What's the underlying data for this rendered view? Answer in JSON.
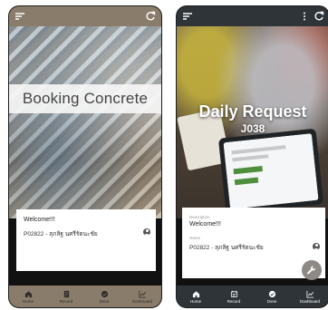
{
  "left_app": {
    "banner_title": "Booking Concrete",
    "welcome": "Welcome!!!",
    "user": "P02822 - สุภสิฐ นศรีรัตนะชัย",
    "nav": [
      {
        "label": "Home",
        "icon": "home-icon"
      },
      {
        "label": "Record",
        "icon": "record-icon"
      },
      {
        "label": "Done",
        "icon": "check-circle-icon"
      },
      {
        "label": "Dashboard",
        "icon": "chart-icon"
      }
    ],
    "colors": {
      "bar": "#8a7c6a"
    }
  },
  "right_app": {
    "title": "Daily Request",
    "code": "J038",
    "description_label": "Description",
    "welcome": "Welcome!!!",
    "name_label": "Name",
    "user": "P02822 - สุภสิฐ นศรีรัตนะชัย",
    "nav": [
      {
        "label": "Home",
        "icon": "home-icon"
      },
      {
        "label": "Record",
        "icon": "record-icon"
      },
      {
        "label": "Done",
        "icon": "check-circle-icon"
      },
      {
        "label": "Dashboard",
        "icon": "chart-icon"
      }
    ],
    "colors": {
      "bar": "#2e3438",
      "fab": "#8d8a86"
    }
  }
}
